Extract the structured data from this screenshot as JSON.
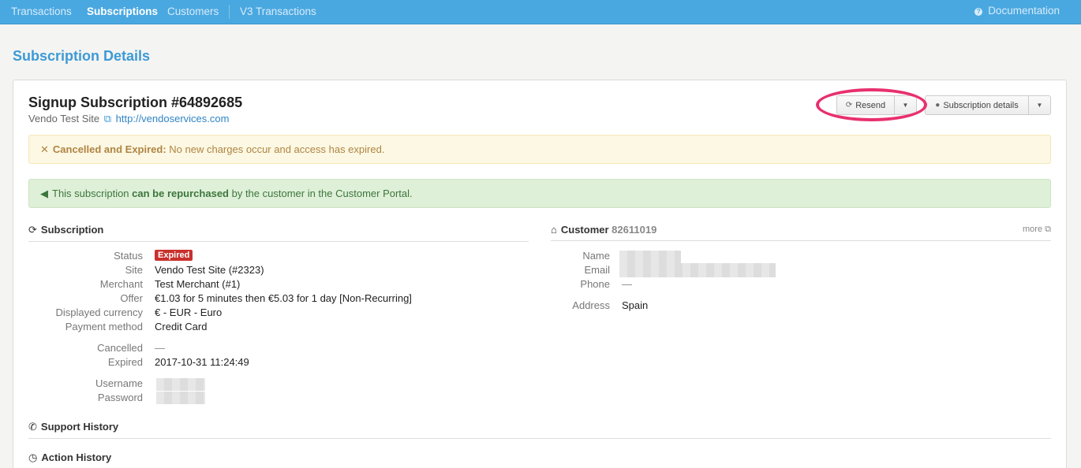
{
  "nav": {
    "items": [
      {
        "label": "Transactions",
        "active": false
      },
      {
        "label": "Subscriptions",
        "active": true
      },
      {
        "label": "Customers",
        "active": false
      },
      {
        "label": "V3 Transactions",
        "active": false
      }
    ],
    "documentation": "Documentation"
  },
  "page_title": "Subscription Details",
  "subscription": {
    "heading": "Signup Subscription #64892685",
    "site_name": "Vendo Test Site",
    "site_url": "http://vendoservices.com"
  },
  "actions": {
    "resend": "Resend",
    "subscription_details": "Subscription details"
  },
  "alerts": {
    "warning_strong": "Cancelled and Expired:",
    "warning_text": " No new charges occur and access has expired.",
    "info_pre": "This subscription ",
    "info_strong": "can be repurchased",
    "info_post": " by the customer in the Customer Portal."
  },
  "subscription_section": {
    "title": "Subscription",
    "status_label": "Status",
    "status_value": "Expired",
    "site_label": "Site",
    "site_value": "Vendo Test Site (#2323)",
    "merchant_label": "Merchant",
    "merchant_value": "Test Merchant (#1)",
    "offer_label": "Offer",
    "offer_value": "€1.03 for 5 minutes then €5.03 for 1 day [Non-Recurring]",
    "currency_label": "Displayed currency",
    "currency_value": "€ - EUR - Euro",
    "payment_label": "Payment method",
    "payment_value": "Credit Card",
    "cancelled_label": "Cancelled",
    "cancelled_value": "—",
    "expired_label": "Expired",
    "expired_value": "2017-10-31 11:24:49",
    "username_label": "Username",
    "password_label": "Password"
  },
  "customer_section": {
    "title": "Customer",
    "id": "82611019",
    "more": "more",
    "name_label": "Name",
    "email_label": "Email",
    "phone_label": "Phone",
    "phone_value": "—",
    "address_label": "Address",
    "address_value": "Spain"
  },
  "support_history": "Support History",
  "action_history": "Action History",
  "colors": {
    "nav_bg": "#4aa8e0",
    "title_blue": "#3d9ad6",
    "badge_red": "#c9302c",
    "highlight": "#e8306e"
  }
}
